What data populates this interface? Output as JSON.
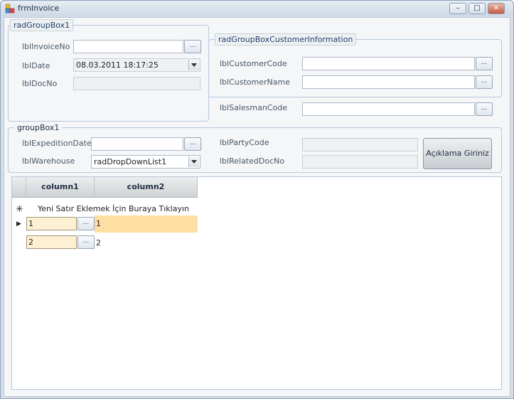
{
  "window": {
    "title": "frmInvoice",
    "minimize_label": "–",
    "maximize_label": "□",
    "close_label": "✕"
  },
  "group1": {
    "title": "radGroupBox1",
    "invoice_no_label": "lblInvoiceNo",
    "invoice_no_value": "",
    "date_label": "lblDate",
    "date_value": "08.03.2011 18:17:25",
    "doc_no_label": "lblDocNo",
    "doc_no_value": ""
  },
  "customer_group": {
    "title": "radGroupBoxCustomerInformation",
    "customer_code_label": "lblCustomerCode",
    "customer_code_value": "",
    "customer_name_label": "lblCustomerName",
    "customer_name_value": ""
  },
  "salesman": {
    "label": "lblSalesmanCode",
    "value": ""
  },
  "group2": {
    "title": "groupBox1",
    "expedition_date_label": "lblExpeditionDate",
    "expedition_date_value": "",
    "warehouse_label": "lblWarehouse",
    "warehouse_value": "radDropDownList1",
    "party_code_label": "lblPartyCode",
    "party_code_value": "",
    "related_doc_label": "lblRelatedDocNo",
    "related_doc_value": "",
    "description_button": "Açıklama Giriniz"
  },
  "grid": {
    "columns": [
      "column1",
      "column2"
    ],
    "new_row_hint": "Yeni Satır Eklemek İçin Buraya Tıklayın",
    "new_row_marker": "✳",
    "current_row_marker": "▶",
    "rows": [
      {
        "column1": "1",
        "column2": "1"
      },
      {
        "column1": "2",
        "column2": "2"
      }
    ]
  },
  "ellipsis": "..."
}
